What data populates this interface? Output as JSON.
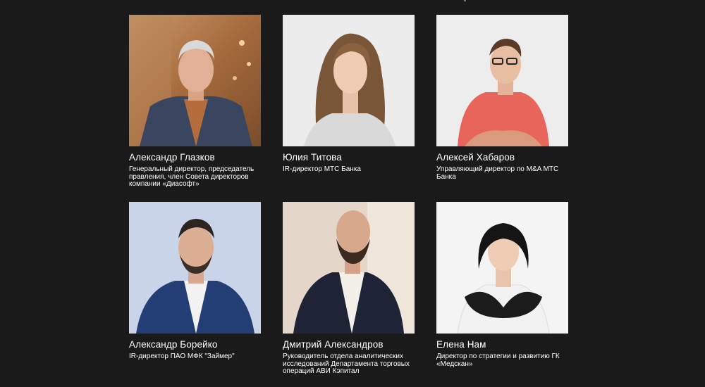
{
  "speakers": [
    {
      "name": "Александр Глазков",
      "role": "Генеральный директор, председатель правления, член Совета директоров компании «Диасофт»",
      "photo_icon": "portrait-man-suit-warm-background"
    },
    {
      "name": "Юлия Титова",
      "role": "IR-директор МТС Банка",
      "photo_icon": "portrait-woman-long-hair"
    },
    {
      "name": "Алексей Хабаров",
      "role": "Управляющий директор по M&A МТС Банка",
      "photo_icon": "portrait-man-glasses-red-shirt"
    },
    {
      "name": "Александр Борейко",
      "role": "IR-директор ПАО МФК \"Займер\"",
      "photo_icon": "portrait-man-beard-blue-suit"
    },
    {
      "name": "Дмитрий Александров",
      "role": "Руководитель отдела аналитических исследований Департамента торговых операций АВИ Кэпитал",
      "photo_icon": "portrait-man-bald-beard"
    },
    {
      "name": "Елена Нам",
      "role": "Директор по стратегии и развитию ГК «Медскан»",
      "photo_icon": "portrait-woman-short-hair"
    }
  ],
  "colors": {
    "background": "#1a1a1b",
    "text": "#ffffff"
  }
}
